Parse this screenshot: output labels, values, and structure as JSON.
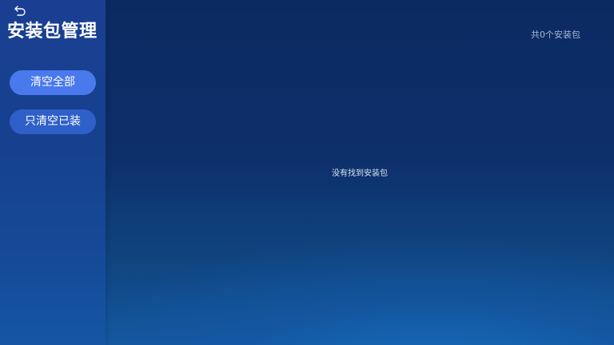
{
  "sidebar": {
    "back_icon": "back-arrow-icon",
    "title": "安装包管理",
    "buttons": {
      "clear_all": "清空全部",
      "clear_installed": "只清空已装"
    }
  },
  "main": {
    "package_count": "共0个安装包",
    "empty_message": "没有找到安装包"
  },
  "colors": {
    "primary_button": "#4a79ee",
    "secondary_button": "#2f5fc8",
    "sidebar_bg": "#1a3f92",
    "main_bg": "#0c2a62"
  }
}
